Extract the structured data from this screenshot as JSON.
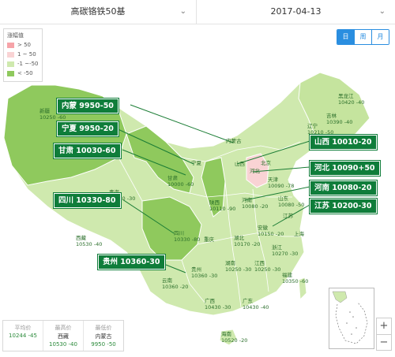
{
  "selectors": {
    "product": "高碳铬铁50基",
    "date": "2017-04-13"
  },
  "tabs": [
    "日",
    "周",
    "月"
  ],
  "legend": {
    "title": "涨幅值",
    "items": [
      {
        "label": "> 50",
        "color": "#f6a3a8"
      },
      {
        "label": "1 ~ 50",
        "color": "#f9d3d4"
      },
      {
        "label": "-1 ~-50",
        "color": "#cfe9ae"
      },
      {
        "label": "< -50",
        "color": "#8fc95d"
      }
    ]
  },
  "callouts": [
    {
      "text": "内蒙 9950-50"
    },
    {
      "text": "宁夏 9950-20"
    },
    {
      "text": "甘肃 10030-60"
    },
    {
      "text": "四川 10330-80"
    },
    {
      "text": "贵州 10360-30"
    },
    {
      "text": "山西 10010-20"
    },
    {
      "text": "河北 10090+50"
    },
    {
      "text": "河南 10080-20"
    },
    {
      "text": "江苏 10200-30"
    }
  ],
  "labels": [
    {
      "name": "黑龙江",
      "value": "10420 -40"
    },
    {
      "name": "吉林",
      "value": "10390 -40"
    },
    {
      "name": "辽宁",
      "value": "10210 -50"
    },
    {
      "name": "新疆",
      "value": "10250 -60"
    },
    {
      "name": "内蒙古",
      "value": ""
    },
    {
      "name": "宁夏",
      "value": ""
    },
    {
      "name": "甘肃",
      "value": "10000 -60"
    },
    {
      "name": "青海",
      "value": "10090 -30"
    },
    {
      "name": "山西",
      "value": ""
    },
    {
      "name": "河北",
      "value": ""
    },
    {
      "name": "北京",
      "value": ""
    },
    {
      "name": "天津",
      "value": "10090 -78"
    },
    {
      "name": "山东",
      "value": "10080 -50"
    },
    {
      "name": "河南",
      "value": "10080 -20"
    },
    {
      "name": "陕西",
      "value": "10110 -90"
    },
    {
      "name": "西藏",
      "value": "10530 -40"
    },
    {
      "name": "四川",
      "value": "10330 -80"
    },
    {
      "name": "重庆",
      "value": ""
    },
    {
      "name": "湖北",
      "value": "10170 -20"
    },
    {
      "name": "安徽",
      "value": "10150 -20"
    },
    {
      "name": "江苏",
      "value": ""
    },
    {
      "name": "上海",
      "value": ""
    },
    {
      "name": "浙江",
      "value": "10270 -30"
    },
    {
      "name": "湖南",
      "value": "10250 -30"
    },
    {
      "name": "江西",
      "value": "10250 -30"
    },
    {
      "name": "贵州",
      "value": "10360 -30"
    },
    {
      "name": "云南",
      "value": "10360 -20"
    },
    {
      "name": "广西",
      "value": "10430 -30"
    },
    {
      "name": "广东",
      "value": "10430 -40"
    },
    {
      "name": "福建",
      "value": "10350 -60"
    },
    {
      "name": "海南",
      "value": "10520 -20"
    }
  ],
  "stats": [
    {
      "label": "平均价",
      "v1": "10244 -45",
      "v2": ""
    },
    {
      "label": "最高价",
      "v1": "西藏",
      "v2": "10530 -40"
    },
    {
      "label": "最低价",
      "v1": "内蒙古",
      "v2": "9950 -50"
    }
  ],
  "zoom": {
    "in": "+",
    "out": "−"
  }
}
